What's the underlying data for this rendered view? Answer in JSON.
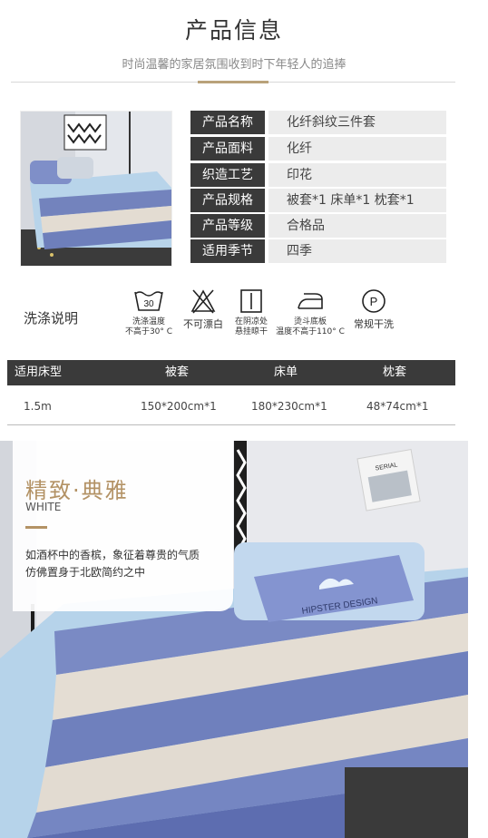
{
  "header": {
    "title": "产品信息",
    "subtitle": "时尚温馨的家居氛围收到时下年轻人的追捧"
  },
  "info": [
    {
      "label": "产品名称",
      "value": "化纤斜纹三件套"
    },
    {
      "label": "产品面料",
      "value": "化纤"
    },
    {
      "label": "织造工艺",
      "value": "印花"
    },
    {
      "label": "产品规格",
      "value": "被套*1  床单*1  枕套*1"
    },
    {
      "label": "产品等级",
      "value": "合格品"
    },
    {
      "label": "适用季节",
      "value": "四季"
    }
  ],
  "wash": {
    "title": "洗涤说明",
    "items": [
      {
        "icon": "wash-30-icon",
        "line1": "洗涤温度",
        "line2": "不高于30° C",
        "badge": "30"
      },
      {
        "icon": "no-bleach-icon",
        "line1": "不可漂白",
        "line2": ""
      },
      {
        "icon": "hang-dry-icon",
        "line1": "在阴凉处",
        "line2": "悬挂晾干"
      },
      {
        "icon": "iron-icon",
        "line1": "烫斗底板",
        "line2": "温度不高于110° C"
      },
      {
        "icon": "dry-clean-icon",
        "line1": "常规干洗",
        "line2": "",
        "badge": "P"
      }
    ]
  },
  "size_table": {
    "headers": [
      "适用床型",
      "被套",
      "床单",
      "枕套"
    ],
    "rows": [
      [
        "1.5m",
        "150*200cm*1",
        "180*230cm*1",
        "48*74cm*1"
      ]
    ]
  },
  "hero": {
    "title": "精致·典雅",
    "subtitle": "WHITE",
    "desc_line1": "如酒杯中的香槟，象征着尊贵的气质",
    "desc_line2": "仿佛置身于北欧简约之中",
    "pillow_text": "HIPSTER DESIGN",
    "book_text": "SERIAL"
  },
  "colors": {
    "dark": "#3a3a3a",
    "gold": "#b39265",
    "stripe_blue": "#7383bd",
    "stripe_beige": "#e3dcd2",
    "light_blue": "#a9cbe6"
  }
}
